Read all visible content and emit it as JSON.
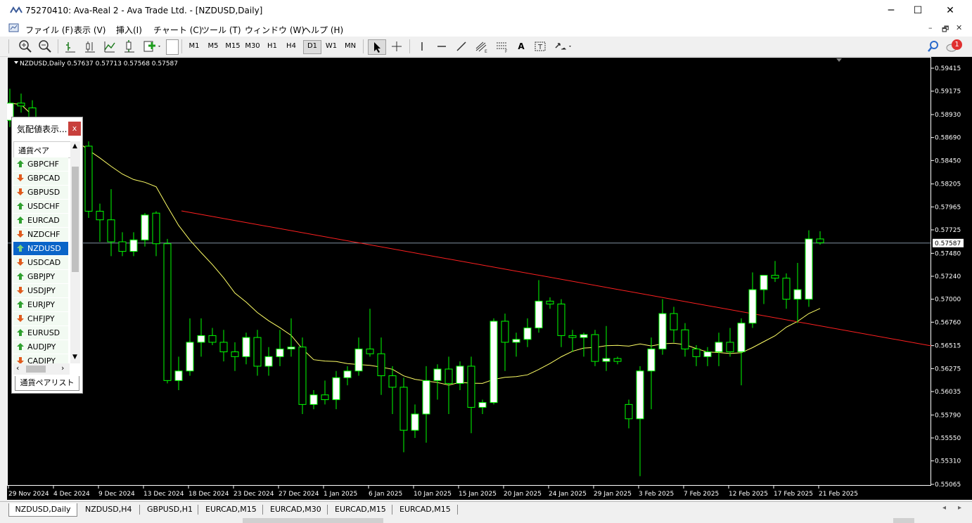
{
  "window": {
    "title": "75270410: Ava-Real 2 - Ava Trade Ltd. - [NZDUSD,Daily]",
    "minimize": "─",
    "maximize": "☐",
    "close": "✕"
  },
  "menu": [
    "ファイル (F)",
    "表示 (V)",
    "挿入(I)",
    "チャート (C)",
    "ツール (T)",
    "ウィンドウ (W)",
    "ヘルプ (H)"
  ],
  "mdi_controls": [
    "–",
    "🗗",
    "✕"
  ],
  "toolbar": {
    "timeframes": [
      "M1",
      "M5",
      "M15",
      "M30",
      "H1",
      "H4",
      "D1",
      "W1",
      "MN"
    ],
    "active_timeframe": "D1",
    "text_tool": "A",
    "notification_count": "1"
  },
  "chart": {
    "info": "NZDUSD,Daily  0.57637 0.57713 0.57568 0.57587",
    "current_price": "0.57587",
    "price_labels": [
      "0.59415",
      "0.59175",
      "0.58930",
      "0.58690",
      "0.58450",
      "0.58205",
      "0.57965",
      "0.57725",
      "0.57480",
      "0.57240",
      "0.57000",
      "0.56760",
      "0.56515",
      "0.56275",
      "0.56035",
      "0.55790",
      "0.55550",
      "0.55310",
      "0.55065"
    ],
    "date_labels": [
      "29 Nov 2024",
      "4 Dec 2024",
      "9 Dec 2024",
      "13 Dec 2024",
      "18 Dec 2024",
      "23 Dec 2024",
      "27 Dec 2024",
      "1 Jan 2025",
      "6 Jan 2025",
      "10 Jan 2025",
      "15 Jan 2025",
      "20 Jan 2025",
      "24 Jan 2025",
      "29 Jan 2025",
      "3 Feb 2025",
      "7 Feb 2025",
      "12 Feb 2025",
      "17 Feb 2025",
      "21 Feb 2025"
    ],
    "colors": {
      "background": "#000000",
      "bull": "#ffffff",
      "bear": "#000000",
      "wick": "#00ff00",
      "ma": "#ffff66",
      "trendline": "#ff2020",
      "bidline": "#8090a0"
    }
  },
  "market_watch": {
    "title": "気配値表示...",
    "close": "x",
    "column_header": "通貨ペア",
    "symbols": [
      {
        "name": "GBPCHF",
        "dir": "up"
      },
      {
        "name": "GBPCAD",
        "dir": "down"
      },
      {
        "name": "GBPUSD",
        "dir": "down"
      },
      {
        "name": "USDCHF",
        "dir": "up"
      },
      {
        "name": "EURCAD",
        "dir": "up"
      },
      {
        "name": "NZDCHF",
        "dir": "down"
      },
      {
        "name": "NZDUSD",
        "dir": "up",
        "selected": true
      },
      {
        "name": "USDCAD",
        "dir": "down"
      },
      {
        "name": "GBPJPY",
        "dir": "up"
      },
      {
        "name": "USDJPY",
        "dir": "down"
      },
      {
        "name": "EURJPY",
        "dir": "up"
      },
      {
        "name": "CHFJPY",
        "dir": "down"
      },
      {
        "name": "EURUSD",
        "dir": "up"
      },
      {
        "name": "AUDJPY",
        "dir": "up"
      },
      {
        "name": "CADJPY",
        "dir": "down"
      }
    ],
    "tab": "通貨ペアリスト"
  },
  "chart_tabs": [
    "NZDUSD,Daily",
    "NZDUSD,H4",
    "GBPUSD,H1",
    "EURCAD,M15",
    "EURCAD,M30",
    "EURCAD,M15",
    "EURCAD,M15"
  ],
  "active_tab": "NZDUSD,Daily",
  "chart_data": {
    "type": "candlestick",
    "symbol": "NZDUSD",
    "timeframe": "Daily",
    "ylim": [
      0.55065,
      0.59415
    ],
    "ohlc": [
      [
        0.5887,
        0.592,
        0.588,
        0.5905
      ],
      [
        0.5905,
        0.5915,
        0.5895,
        0.5902
      ],
      [
        0.59,
        0.5908,
        0.586,
        0.587
      ],
      [
        0.5875,
        0.5882,
        0.582,
        0.5845
      ],
      [
        0.584,
        0.5855,
        0.58,
        0.583
      ],
      [
        0.583,
        0.5845,
        0.5825,
        0.584
      ],
      [
        0.5835,
        0.5885,
        0.583,
        0.5862
      ],
      [
        0.586,
        0.5865,
        0.5785,
        0.5792
      ],
      [
        0.5792,
        0.58,
        0.576,
        0.5783
      ],
      [
        0.5783,
        0.5815,
        0.5745,
        0.576
      ],
      [
        0.576,
        0.577,
        0.5745,
        0.575
      ],
      [
        0.575,
        0.577,
        0.5745,
        0.5762
      ],
      [
        0.5762,
        0.579,
        0.5755,
        0.5788
      ],
      [
        0.579,
        0.5792,
        0.5745,
        0.5758
      ],
      [
        0.5758,
        0.5763,
        0.5612,
        0.5615
      ],
      [
        0.5615,
        0.564,
        0.5605,
        0.5625
      ],
      [
        0.5625,
        0.568,
        0.562,
        0.5655
      ],
      [
        0.5655,
        0.568,
        0.564,
        0.5662
      ],
      [
        0.5662,
        0.567,
        0.5652,
        0.5655
      ],
      [
        0.5655,
        0.5668,
        0.5635,
        0.5645
      ],
      [
        0.5645,
        0.5655,
        0.5625,
        0.564
      ],
      [
        0.564,
        0.5665,
        0.5632,
        0.566
      ],
      [
        0.566,
        0.5668,
        0.562,
        0.563
      ],
      [
        0.563,
        0.565,
        0.562,
        0.564
      ],
      [
        0.564,
        0.5668,
        0.563,
        0.5648
      ],
      [
        0.5648,
        0.568,
        0.564,
        0.565
      ],
      [
        0.565,
        0.566,
        0.558,
        0.559
      ],
      [
        0.559,
        0.5605,
        0.5585,
        0.56
      ],
      [
        0.56,
        0.5615,
        0.559,
        0.5595
      ],
      [
        0.5595,
        0.5625,
        0.5585,
        0.5618
      ],
      [
        0.5618,
        0.563,
        0.561,
        0.5625
      ],
      [
        0.5625,
        0.566,
        0.562,
        0.5648
      ],
      [
        0.5648,
        0.569,
        0.564,
        0.5643
      ],
      [
        0.5643,
        0.566,
        0.56,
        0.562
      ],
      [
        0.562,
        0.563,
        0.558,
        0.5608
      ],
      [
        0.5608,
        0.5618,
        0.554,
        0.5563
      ],
      [
        0.5563,
        0.559,
        0.5555,
        0.558
      ],
      [
        0.558,
        0.563,
        0.555,
        0.5615
      ],
      [
        0.5615,
        0.5632,
        0.5595,
        0.5627
      ],
      [
        0.5627,
        0.564,
        0.558,
        0.5612
      ],
      [
        0.5612,
        0.5635,
        0.5605,
        0.563
      ],
      [
        0.563,
        0.564,
        0.556,
        0.5587
      ],
      [
        0.5587,
        0.5595,
        0.558,
        0.5592
      ],
      [
        0.5592,
        0.568,
        0.559,
        0.5677
      ],
      [
        0.5677,
        0.5685,
        0.5625,
        0.5655
      ],
      [
        0.5655,
        0.5665,
        0.564,
        0.5658
      ],
      [
        0.5658,
        0.568,
        0.565,
        0.567
      ],
      [
        0.567,
        0.572,
        0.5665,
        0.5698
      ],
      [
        0.5698,
        0.5702,
        0.569,
        0.5695
      ],
      [
        0.5695,
        0.57,
        0.565,
        0.5662
      ],
      [
        0.5662,
        0.5668,
        0.5645,
        0.566
      ],
      [
        0.566,
        0.5665,
        0.564,
        0.5663
      ],
      [
        0.5663,
        0.5668,
        0.563,
        0.5635
      ],
      [
        0.5635,
        0.5672,
        0.5625,
        0.5638
      ],
      [
        0.5638,
        0.564,
        0.5632,
        0.5635
      ],
      [
        0.559,
        0.5595,
        0.5565,
        0.5575
      ],
      [
        0.5575,
        0.563,
        0.5515,
        0.5625
      ],
      [
        0.5625,
        0.566,
        0.5585,
        0.5648
      ],
      [
        0.5648,
        0.57,
        0.5642,
        0.5685
      ],
      [
        0.5685,
        0.5692,
        0.5655,
        0.5668
      ],
      [
        0.5668,
        0.5675,
        0.564,
        0.5648
      ],
      [
        0.5648,
        0.5652,
        0.563,
        0.564
      ],
      [
        0.564,
        0.565,
        0.563,
        0.5645
      ],
      [
        0.5645,
        0.5665,
        0.563,
        0.5655
      ],
      [
        0.5655,
        0.567,
        0.564,
        0.5645
      ],
      [
        0.5645,
        0.568,
        0.561,
        0.5675
      ],
      [
        0.5675,
        0.5728,
        0.567,
        0.571
      ],
      [
        0.571,
        0.5722,
        0.5695,
        0.5725
      ],
      [
        0.5725,
        0.574,
        0.5718,
        0.5722
      ],
      [
        0.5722,
        0.5727,
        0.569,
        0.57
      ],
      [
        0.57,
        0.5738,
        0.5675,
        0.571
      ],
      [
        0.57,
        0.5772,
        0.5692,
        0.5763
      ],
      [
        0.5763,
        0.5771,
        0.5757,
        0.5759
      ]
    ]
  }
}
